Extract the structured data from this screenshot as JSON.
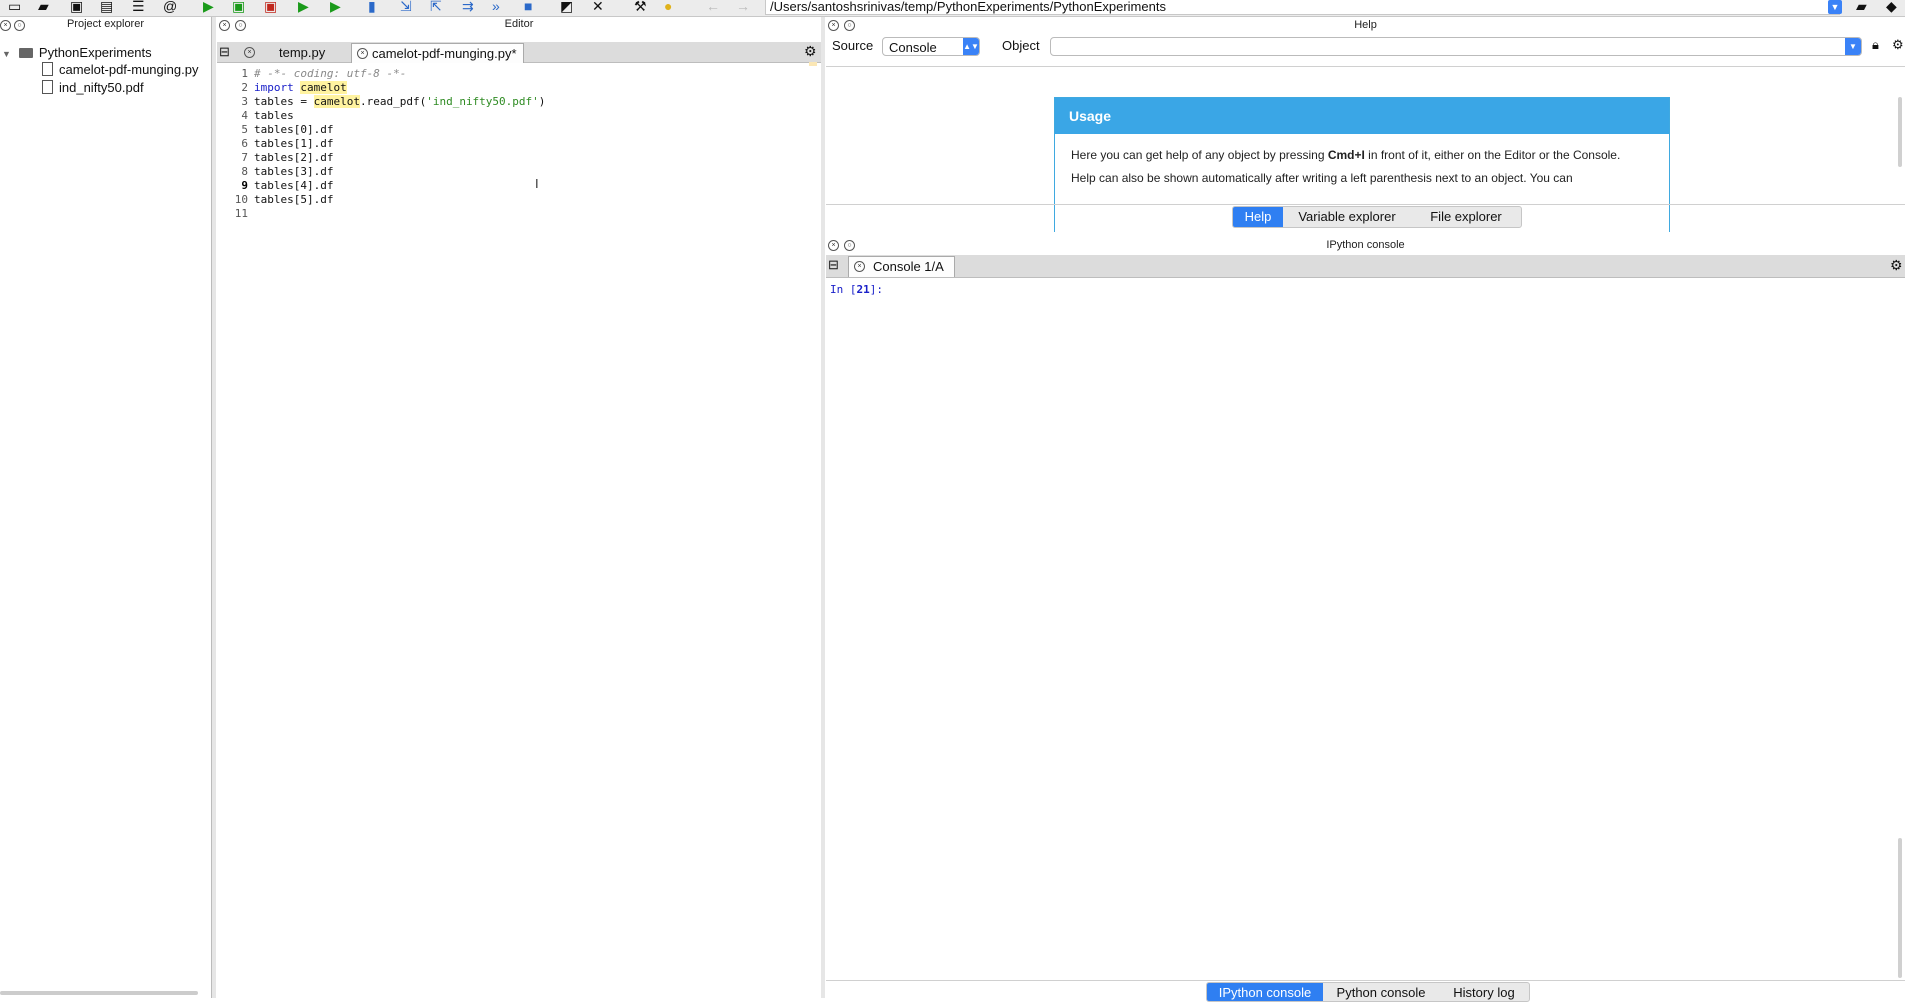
{
  "toolbar": {
    "path": "/Users/santoshsrinivas/temp/PythonExperiments/PythonExperiments",
    "icons": [
      "new-file",
      "open-folder",
      "save",
      "save-all",
      "list",
      "email",
      "run",
      "run-cell",
      "run-cell-advance",
      "run-selection",
      "debug",
      "step",
      "step-into",
      "step-return",
      "continue",
      "stop",
      "maximize",
      "fullscreen",
      "preferences",
      "python-path",
      "back",
      "forward"
    ]
  },
  "project_explorer": {
    "title": "Project explorer",
    "root": "PythonExperiments",
    "files": [
      "camelot-pdf-munging.py",
      "ind_nifty50.pdf"
    ]
  },
  "editor": {
    "title": "Editor",
    "tabs": [
      {
        "label": "temp.py",
        "active": false
      },
      {
        "label": "camelot-pdf-munging.py*",
        "active": true
      }
    ],
    "lines": [
      {
        "num": "1",
        "text": "# -*- coding: utf-8 -*-"
      },
      {
        "num": "2",
        "kw": "import",
        "rest": "camelot"
      },
      {
        "num": "3",
        "a": "tables = ",
        "b": "camelot",
        "c": ".read_pdf(",
        "s": "'ind_nifty50.pdf'",
        "d": ")"
      },
      {
        "num": "4",
        "text": "tables"
      },
      {
        "num": "5",
        "text": "tables[0].df"
      },
      {
        "num": "6",
        "text": "tables[1].df"
      },
      {
        "num": "7",
        "text": "tables[2].df"
      },
      {
        "num": "8",
        "text": "tables[3].df"
      },
      {
        "num": "9",
        "text": "tables[4].df"
      },
      {
        "num": "10",
        "text": "tables[5].df"
      },
      {
        "num": "11",
        "text": ""
      }
    ]
  },
  "help": {
    "title": "Help",
    "source_label": "Source",
    "source_value": "Console",
    "object_label": "Object",
    "usage_title": "Usage",
    "usage_p1_pre": "Here you can get help of any object by pressing ",
    "usage_p1_key": "Cmd+I",
    "usage_p1_post": " in front of it, either on the Editor or the Console.",
    "usage_p2": "Help can also be shown automatically after writing a left parenthesis next to an object. You can",
    "tabs": [
      "Help",
      "Variable explorer",
      "File explorer"
    ],
    "selected_tab": "Help"
  },
  "console": {
    "title": "IPython console",
    "tab_label": "Console 1/A",
    "prompt_in": "In [",
    "prompt_num": "21",
    "prompt_end": "]:",
    "tabs": [
      "IPython console",
      "Python console",
      "History log"
    ],
    "selected_tab": "IPython console"
  },
  "colors": {
    "accent": "#2f7ff2",
    "usage_header": "#3aa6e6",
    "keyword": "#1a20c9",
    "string": "#2e8b22",
    "highlight": "#fff3a0"
  }
}
